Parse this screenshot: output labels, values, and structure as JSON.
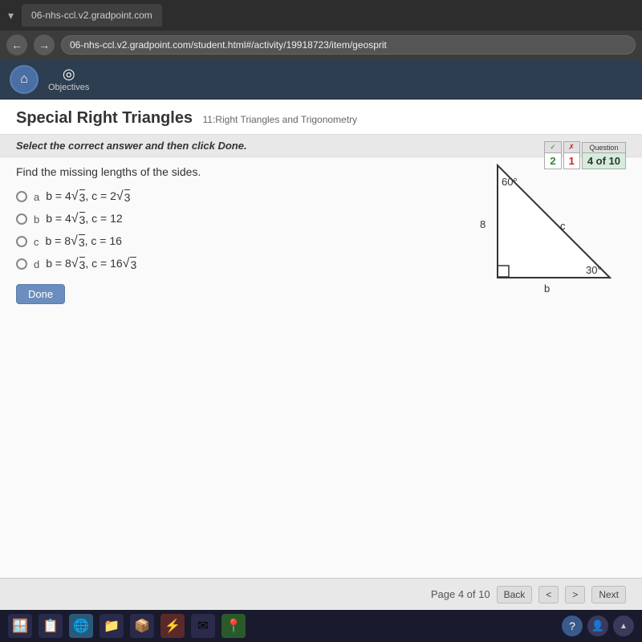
{
  "browser": {
    "tab_label": "06-nhs-ccl.v2.gradpoint.com",
    "address": "06-nhs-ccl.v2.gradpoint.com/student.html#/activity/19918723/item/geosprit",
    "chevron": "▾"
  },
  "header": {
    "home_icon": "⌂",
    "objectives_icon": "◎",
    "objectives_label": "Objectives"
  },
  "page": {
    "title": "Special Right Triangles",
    "subtitle": "11:Right Triangles and Trigonometry"
  },
  "instruction": {
    "prefix": "Select the correct answer and then click ",
    "bold": "Done."
  },
  "score": {
    "checkmark_header": "✓",
    "checkmark_value": "2",
    "cross_header": "✗",
    "cross_value": "1",
    "question_header": "Question",
    "question_value": "4 of 10"
  },
  "question": {
    "prompt": "Find the missing lengths of the sides.",
    "choices": [
      {
        "label": "a",
        "text_html": "b = 4√3, c = 2√3"
      },
      {
        "label": "b",
        "text_html": "b = 4√3, c = 12"
      },
      {
        "label": "c",
        "text_html": "b = 8√3, c = 16"
      },
      {
        "label": "d",
        "text_html": "b = 8√3, c = 16√3"
      }
    ]
  },
  "triangle": {
    "angle_top": "60°",
    "angle_bottom_right": "30°",
    "side_left": "8",
    "side_hyp": "c",
    "side_bottom": "b"
  },
  "buttons": {
    "done": "Done"
  },
  "pagination": {
    "page_label": "Page  4 of 10",
    "back_label": "Back",
    "prev_label": "<",
    "next_label": ">",
    "next_text_label": "Next"
  },
  "taskbar": {
    "icons": [
      "🪟",
      "📋",
      "🌐",
      "📁",
      "📦",
      "⚡",
      "✉",
      "📍"
    ],
    "right_icons": [
      "?",
      "👤",
      "^"
    ]
  }
}
